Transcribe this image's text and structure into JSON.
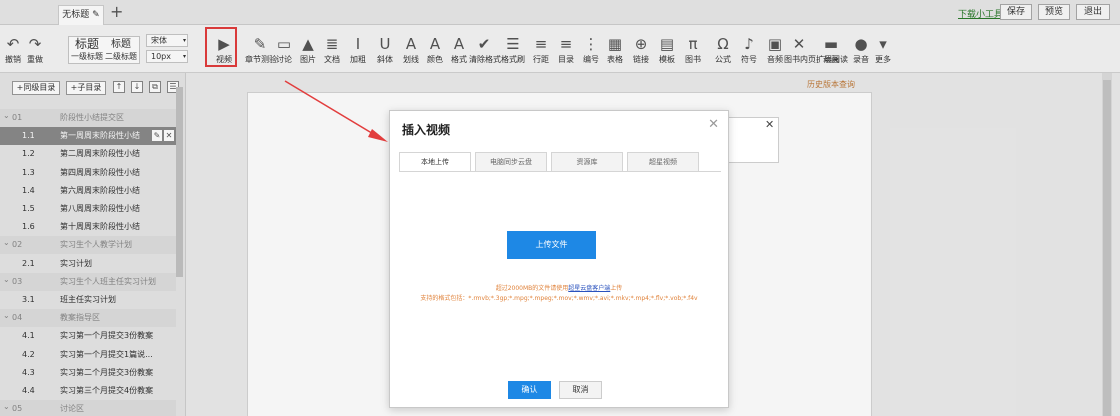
{
  "colors": {
    "accent": "#1e88e5",
    "highlight": "#e23d3d",
    "warning_text": "#e0823a",
    "link": "#2a52be",
    "selected_row": "#8a8a8a"
  },
  "topbar": {
    "doc_tab": "无标题",
    "doc_tab_icon": "pencil-icon",
    "add_tab": "+",
    "download_tool": "下载小工具",
    "save": "保存",
    "preview": "预览",
    "exit": "退出"
  },
  "toolbar": {
    "undo": "撤销",
    "redo": "重做",
    "heading": "标题",
    "heading_sub": "一级标题",
    "heading2": "标题",
    "heading2_sub": "二级标题",
    "font_family": "宋体",
    "font_size": "10px",
    "items": [
      {
        "label": "视频",
        "icon": "video-icon",
        "glyph": "▶"
      },
      {
        "label": "章节测验",
        "icon": "quiz-icon",
        "glyph": "✎"
      },
      {
        "label": "讨论",
        "icon": "discuss-icon",
        "glyph": "▭"
      },
      {
        "label": "图片",
        "icon": "image-icon",
        "glyph": "▲"
      },
      {
        "label": "文档",
        "icon": "document-icon",
        "glyph": "≣"
      },
      {
        "label": "加粗",
        "icon": "bold-icon",
        "glyph": "I"
      },
      {
        "label": "斜体",
        "icon": "italic-icon",
        "glyph": "U"
      },
      {
        "label": "划线",
        "icon": "underline-icon",
        "glyph": "A"
      },
      {
        "label": "颜色",
        "icon": "font-color-icon",
        "glyph": "A"
      },
      {
        "label": "格式",
        "icon": "format-icon",
        "glyph": "A"
      },
      {
        "label": "清除格式",
        "icon": "clear-format-icon",
        "glyph": "✔"
      },
      {
        "label": "格式刷",
        "icon": "format-brush-icon",
        "glyph": "☰"
      },
      {
        "label": "行距",
        "icon": "line-spacing-icon",
        "glyph": "≡"
      },
      {
        "label": "目录",
        "icon": "toc-icon",
        "glyph": "≡"
      },
      {
        "label": "编号",
        "icon": "numbering-icon",
        "glyph": "⋮"
      },
      {
        "label": "表格",
        "icon": "table-icon",
        "glyph": "▦"
      },
      {
        "label": "链接",
        "icon": "link-icon",
        "glyph": "⊕"
      },
      {
        "label": "模板",
        "icon": "template-icon",
        "glyph": "▤"
      },
      {
        "label": "图书",
        "icon": "book-icon",
        "glyph": "π"
      },
      {
        "label": "公式",
        "icon": "formula-icon",
        "glyph": "Ω"
      },
      {
        "label": "符号",
        "icon": "symbol-icon",
        "glyph": "♪"
      },
      {
        "label": "音频",
        "icon": "audio-icon",
        "glyph": "▣"
      },
      {
        "label": "图书内页扩展阅读",
        "icon": "extended-reading-icon",
        "glyph": "✕"
      },
      {
        "label": "动画",
        "icon": "animation-icon",
        "glyph": "▬"
      },
      {
        "label": "录音",
        "icon": "record-icon",
        "glyph": "●"
      },
      {
        "label": "更多",
        "icon": "more-icon",
        "glyph": "▾"
      }
    ]
  },
  "sidebar": {
    "add_level1": "+同级目录",
    "add_child": "+子目录",
    "rows": [
      {
        "type": "sec",
        "num": "01",
        "title": "阶段性小结提交区"
      },
      {
        "type": "sel",
        "num": "1.1",
        "title": "第一周周末阶段性小结"
      },
      {
        "type": "item",
        "num": "1.2",
        "title": "第二周周末阶段性小结"
      },
      {
        "type": "item",
        "num": "1.3",
        "title": "第四周周末阶段性小结"
      },
      {
        "type": "item",
        "num": "1.4",
        "title": "第六周周末阶段性小结"
      },
      {
        "type": "item",
        "num": "1.5",
        "title": "第八周周末阶段性小结"
      },
      {
        "type": "item",
        "num": "1.6",
        "title": "第十周周末阶段性小结"
      },
      {
        "type": "sec",
        "num": "02",
        "title": "实习生个人教学计划"
      },
      {
        "type": "item",
        "num": "2.1",
        "title": "实习计划"
      },
      {
        "type": "sec",
        "num": "03",
        "title": "实习生个人班主任实习计划"
      },
      {
        "type": "item",
        "num": "3.1",
        "title": "班主任实习计划"
      },
      {
        "type": "sec",
        "num": "04",
        "title": "教案指导区"
      },
      {
        "type": "item",
        "num": "4.1",
        "title": "实习第一个月提交3份教案"
      },
      {
        "type": "item",
        "num": "4.2",
        "title": "实习第一个月提交1篇说..."
      },
      {
        "type": "item",
        "num": "4.3",
        "title": "实习第二个月提交3份教案"
      },
      {
        "type": "item",
        "num": "4.4",
        "title": "实习第三个月提交4份教案"
      },
      {
        "type": "sec",
        "num": "05",
        "title": "讨论区"
      }
    ]
  },
  "content": {
    "history": "历史版本查询"
  },
  "dialog": {
    "title": "插入视频",
    "tabs": [
      "本地上传",
      "电脑同步云盘",
      "资源库",
      "超星视频"
    ],
    "upload": "上传文件",
    "note_prefix": "超过2000MB的文件请使用",
    "note_link": "超星云盘客户端",
    "note_suffix": "上传",
    "formats": "支持的格式包括：*.rmvb;*.3gp;*.mpg;*.mpeg;*.mov;*.wmv;*.avi;*.mkv;*.mp4;*.flv;*.vob;*.f4v",
    "confirm": "确认",
    "cancel": "取消"
  }
}
